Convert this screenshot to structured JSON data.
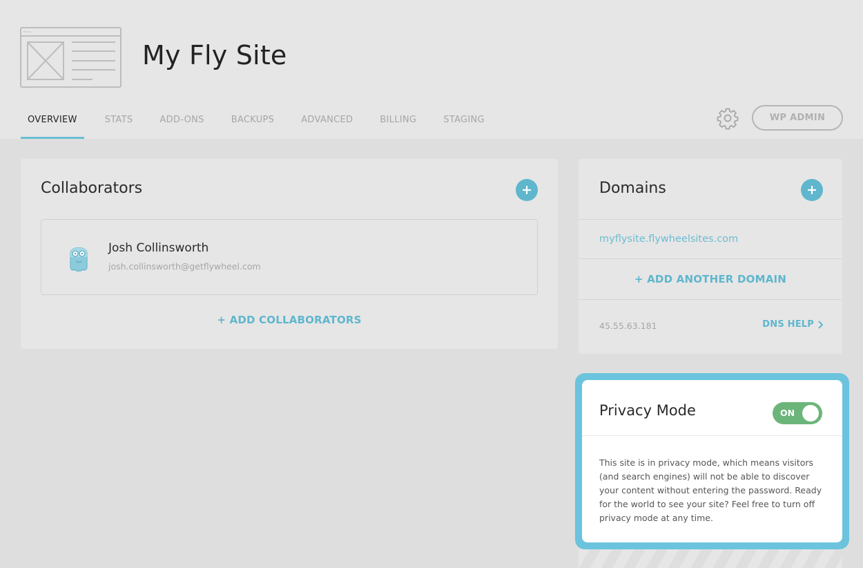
{
  "site": {
    "title": "My Fly Site"
  },
  "tabs": [
    {
      "label": "OVERVIEW",
      "active": true
    },
    {
      "label": "STATS",
      "active": false
    },
    {
      "label": "ADD-ONS",
      "active": false
    },
    {
      "label": "BACKUPS",
      "active": false
    },
    {
      "label": "ADVANCED",
      "active": false
    },
    {
      "label": "BILLING",
      "active": false
    },
    {
      "label": "STAGING",
      "active": false
    }
  ],
  "header_actions": {
    "settings_icon": "gear-icon",
    "wp_admin_label": "WP ADMIN"
  },
  "collaborators": {
    "title": "Collaborators",
    "add_icon": "plus-icon",
    "items": [
      {
        "name": "Josh Collinsworth",
        "email": "josh.collinsworth@getflywheel.com",
        "avatar": "owl-avatar"
      }
    ],
    "add_label": "+ ADD COLLABORATORS"
  },
  "domains": {
    "title": "Domains",
    "add_icon": "plus-icon",
    "primary_domain": "myflysite.flywheelsites.com",
    "add_label": "+ ADD ANOTHER DOMAIN",
    "ip": "45.55.63.181",
    "dns_help_label": "DNS HELP",
    "dns_help_icon": "chevron-right-icon"
  },
  "privacy": {
    "title": "Privacy Mode",
    "toggle_label": "ON",
    "enabled": true,
    "description": "This site is in privacy mode, which means visitors (and search engines) will not be able to discover your content without entering the password. Ready for the world to see your site? Feel free to turn off privacy mode at any time."
  },
  "colors": {
    "accent": "#5fb6cd",
    "highlight_border": "#6bc3dd",
    "toggle_on": "#6cb57a",
    "background": "#dedede",
    "panel": "#e6e6e6"
  }
}
